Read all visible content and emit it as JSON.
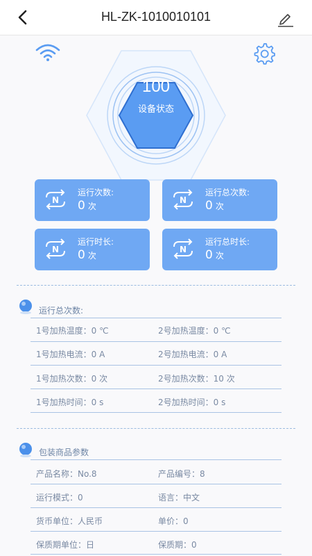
{
  "header": {
    "title": "HL-ZK-1010010101",
    "back_icon": "chevron-left-icon",
    "edit_icon": "pencil-icon"
  },
  "status": {
    "value": "100",
    "label": "设备状态"
  },
  "cards": [
    {
      "label": "运行次数:",
      "value": "0",
      "unit": "次"
    },
    {
      "label": "运行总次数:",
      "value": "0",
      "unit": "次"
    },
    {
      "label": "运行时长:",
      "value": "0",
      "unit": "次"
    },
    {
      "label": "运行总时长:",
      "value": "0",
      "unit": "次"
    }
  ],
  "section1": {
    "title": "运行总次数:",
    "rows": [
      [
        "1号加热温度：0 ℃",
        "2号加热温度：0 ℃"
      ],
      [
        "1号加热电流：0 A",
        "2号加热电流：0 A"
      ],
      [
        "1号加热次数：0 次",
        "2号加热次数：10 次"
      ],
      [
        "1号加热时间：0 s",
        "2号加热时间：0 s"
      ]
    ]
  },
  "section2": {
    "title": "包装商品参数",
    "rows": [
      [
        "产品名称：No.8",
        "产品编号：8"
      ],
      [
        "运行模式：0",
        "语言：中文"
      ],
      [
        "货币单位：人民币",
        "单价：0"
      ],
      [
        "保质期单位：日",
        "保质期：0"
      ]
    ]
  },
  "colors": {
    "accent": "#6fa8f3",
    "hex_fill": "#5a9cf2",
    "line": "#a9c3e4"
  }
}
